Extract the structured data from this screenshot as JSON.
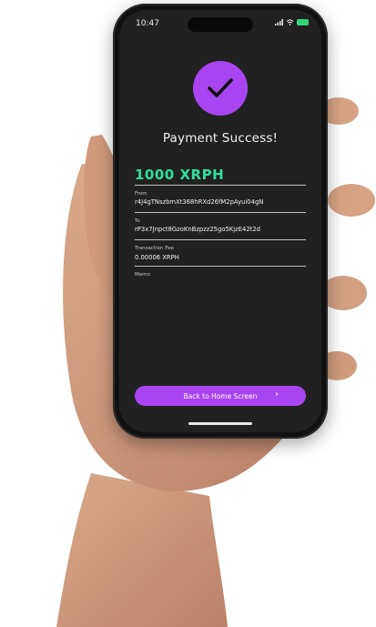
{
  "status_bar": {
    "time": "10:47",
    "signal_icon": "signal-icon",
    "wifi_icon": "wifi-icon",
    "battery_icon": "battery-icon"
  },
  "success": {
    "icon": "check-icon",
    "title": "Payment Success!"
  },
  "amount": "1000 XRPH",
  "details": {
    "from_label": "From",
    "from_value": "r4J4gTNszbmXt368hRXd26fM2pAyui04gN",
    "to_label": "To",
    "to_value": "rP3x7Jnpct8GzoKnBzpzz25go5KjzE42t2d",
    "fee_label": "Transaction Fee",
    "fee_value": "0.00006 XRPH",
    "memo_label": "Memo"
  },
  "cta": {
    "label": "Back to Home Screen",
    "arrow": "›"
  },
  "colors": {
    "accent": "#a945f0",
    "amount": "#2fe09a",
    "screen_bg": "#212121"
  }
}
